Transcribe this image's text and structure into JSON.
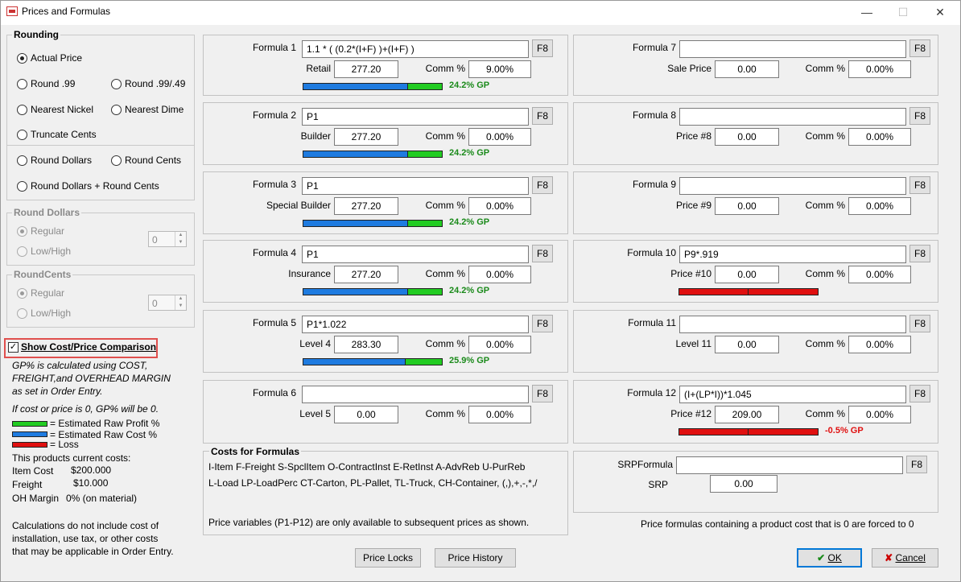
{
  "window": {
    "title": "Prices and Formulas",
    "minimize": "—",
    "maximize": "☐",
    "close": "✕"
  },
  "rounding": {
    "title": "Rounding",
    "options": [
      {
        "label": "Actual Price",
        "checked": true
      },
      {
        "label": "Round .99",
        "checked": false
      },
      {
        "label": "Round .99/.49",
        "checked": false
      },
      {
        "label": "Nearest Nickel",
        "checked": false
      },
      {
        "label": "Nearest Dime",
        "checked": false
      },
      {
        "label": "Truncate Cents",
        "checked": false
      },
      {
        "label": "Round Dollars",
        "checked": false
      },
      {
        "label": "Round Cents",
        "checked": false
      },
      {
        "label": "Round Dollars + Round Cents",
        "checked": false
      }
    ]
  },
  "round_dollars": {
    "title": "Round Dollars",
    "regular": "Regular",
    "lowhigh": "Low/High",
    "value": "0"
  },
  "round_cents": {
    "title": "RoundCents",
    "regular": "Regular",
    "lowhigh": "Low/High",
    "value": "0"
  },
  "comparison": {
    "checkbox_label": "Show Cost/Price Comparison",
    "checked": true,
    "note1": [
      "GP% is calculated using COST,",
      "FREIGHT,and OVERHEAD MARGIN",
      "as set in Order Entry."
    ],
    "note2": "If cost or price is 0, GP% will be 0.",
    "legend": [
      {
        "label": "= Estimated Raw Profit %",
        "color": "#22cc22"
      },
      {
        "label": "= Estimated Raw Cost %",
        "color": "#1e7be0"
      },
      {
        "label": "= Loss",
        "color": "#e01010"
      }
    ],
    "costs_heading": "This products current costs:",
    "item_cost_label": "Item Cost",
    "item_cost": "$200.000",
    "freight_label": "Freight",
    "freight": "$10.000",
    "oh_label": "OH Margin",
    "oh": "0% (on material)",
    "disclaimer": [
      "Calculations do not include cost of",
      "installation, use tax, or other costs",
      "that may be applicable in Order Entry."
    ]
  },
  "labels": {
    "comm": "Comm %",
    "f8": "F8"
  },
  "formulas": [
    {
      "label": "Formula 1",
      "formula": "1.1 * ( (0.2*(I+F) )+(I+F) )",
      "price_label": "Retail",
      "price": "277.20",
      "comm": "9.00%",
      "gp": "24.2% GP",
      "cost_pct": 0.757,
      "profit_pct": 0.243,
      "loss": false
    },
    {
      "label": "Formula 2",
      "formula": "P1",
      "price_label": "Builder",
      "price": "277.20",
      "comm": "0.00%",
      "gp": "24.2% GP",
      "cost_pct": 0.757,
      "profit_pct": 0.243,
      "loss": false
    },
    {
      "label": "Formula 3",
      "formula": "P1",
      "price_label": "Special Builder",
      "price": "277.20",
      "comm": "0.00%",
      "gp": "24.2% GP",
      "cost_pct": 0.757,
      "profit_pct": 0.243,
      "loss": false
    },
    {
      "label": "Formula 4",
      "formula": "P1",
      "price_label": "Insurance",
      "price": "277.20",
      "comm": "0.00%",
      "gp": "24.2% GP",
      "cost_pct": 0.757,
      "profit_pct": 0.243,
      "loss": false
    },
    {
      "label": "Formula 5",
      "formula": "P1*1.022",
      "price_label": "Level 4",
      "price": "283.30",
      "comm": "0.00%",
      "gp": "25.9% GP",
      "cost_pct": 0.741,
      "profit_pct": 0.259,
      "loss": false
    },
    {
      "label": "Formula 6",
      "formula": "",
      "price_label": "Level 5",
      "price": "0.00",
      "comm": "0.00%",
      "gp": "",
      "loss": false
    },
    {
      "label": "Formula 7",
      "formula": "",
      "price_label": "Sale Price",
      "price": "0.00",
      "comm": "0.00%",
      "gp": "",
      "loss": false
    },
    {
      "label": "Formula 8",
      "formula": "",
      "price_label": "Price #8",
      "price": "0.00",
      "comm": "0.00%",
      "gp": "",
      "loss": false
    },
    {
      "label": "Formula 9",
      "formula": "",
      "price_label": "Price #9",
      "price": "0.00",
      "comm": "0.00%",
      "gp": "",
      "loss": false
    },
    {
      "label": "Formula 10",
      "formula": "P9*.919",
      "price_label": "Price #10",
      "price": "0.00",
      "comm": "0.00%",
      "gp": "",
      "loss": true
    },
    {
      "label": "Formula 11",
      "formula": "",
      "price_label": "Level 11",
      "price": "0.00",
      "comm": "0.00%",
      "gp": "",
      "loss": false
    },
    {
      "label": "Formula 12",
      "formula": "(I+(LP*I))*1.045",
      "price_label": "Price #12",
      "price": "209.00",
      "comm": "0.00%",
      "gp": "-0.5% GP",
      "loss": true
    }
  ],
  "costs_for_formulas": {
    "title": "Costs for Formulas",
    "line1": "I-Item  F-Freight  S-SpclItem  O-ContractInst E-RetInst  A-AdvReb  U-PurReb",
    "line2": "L-Load  LP-LoadPerc CT-Carton, PL-Pallet, TL-Truck,  CH-Container, (,),+,-,*,/",
    "line3": "Price variables (P1-P12) are only available to subsequent prices as shown."
  },
  "srp": {
    "formula_label": "SRPFormula",
    "formula": "",
    "srp_label": "SRP",
    "srp": "0.00"
  },
  "forced_note": "Price formulas containing a product cost that is 0 are forced to 0",
  "buttons": {
    "price_locks": "Price Locks",
    "price_history": "Price History",
    "ok": "OK",
    "cancel": "Cancel"
  },
  "colors": {
    "profit": "#22cc22",
    "cost": "#1e7be0",
    "loss": "#e01010",
    "gp_text": "#1a8a1a",
    "loss_text": "#e01010"
  }
}
